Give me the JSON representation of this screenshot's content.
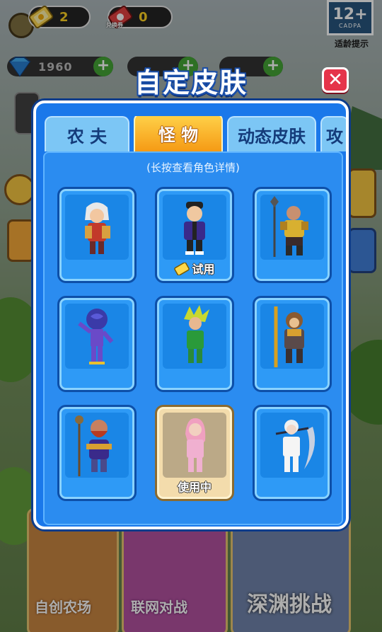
{
  "hud": {
    "tickets_gold": "2",
    "tickets_red": "0",
    "tickets_red_label": "兑换券",
    "diamonds": "1960",
    "age_rating": "12+",
    "age_org": "CADPA",
    "age_label": "适龄提示"
  },
  "dialog": {
    "title": "自定皮肤",
    "tabs": [
      {
        "label": "农 夫",
        "active": false
      },
      {
        "label": "怪 物",
        "active": true
      },
      {
        "label": "动态皮肤",
        "active": false
      },
      {
        "label": "攻",
        "active": false
      }
    ],
    "hint": "(长按查看角色详情)",
    "cards": [
      {
        "character": "white-haired-warrior",
        "label": ""
      },
      {
        "character": "purple-jacket-boy",
        "label": "试用",
        "trial": true
      },
      {
        "character": "armored-halberd-general",
        "label": ""
      },
      {
        "character": "purple-rose-man",
        "label": ""
      },
      {
        "character": "green-hair-fighter",
        "label": ""
      },
      {
        "character": "monkey-king",
        "label": ""
      },
      {
        "character": "bearded-monk",
        "label": ""
      },
      {
        "character": "pink-suit-lady",
        "label": "使用中",
        "in_use": true
      },
      {
        "character": "white-suit-reaper",
        "label": ""
      }
    ]
  },
  "background": {
    "buttons": [
      "自创农场",
      "联网对战",
      "深渊挑战"
    ]
  },
  "colors": {
    "dialog_blue": "#1a78ea",
    "tab_active": "#f59a14",
    "close_red": "#e5344a",
    "in_use_card": "#f3dcac"
  }
}
